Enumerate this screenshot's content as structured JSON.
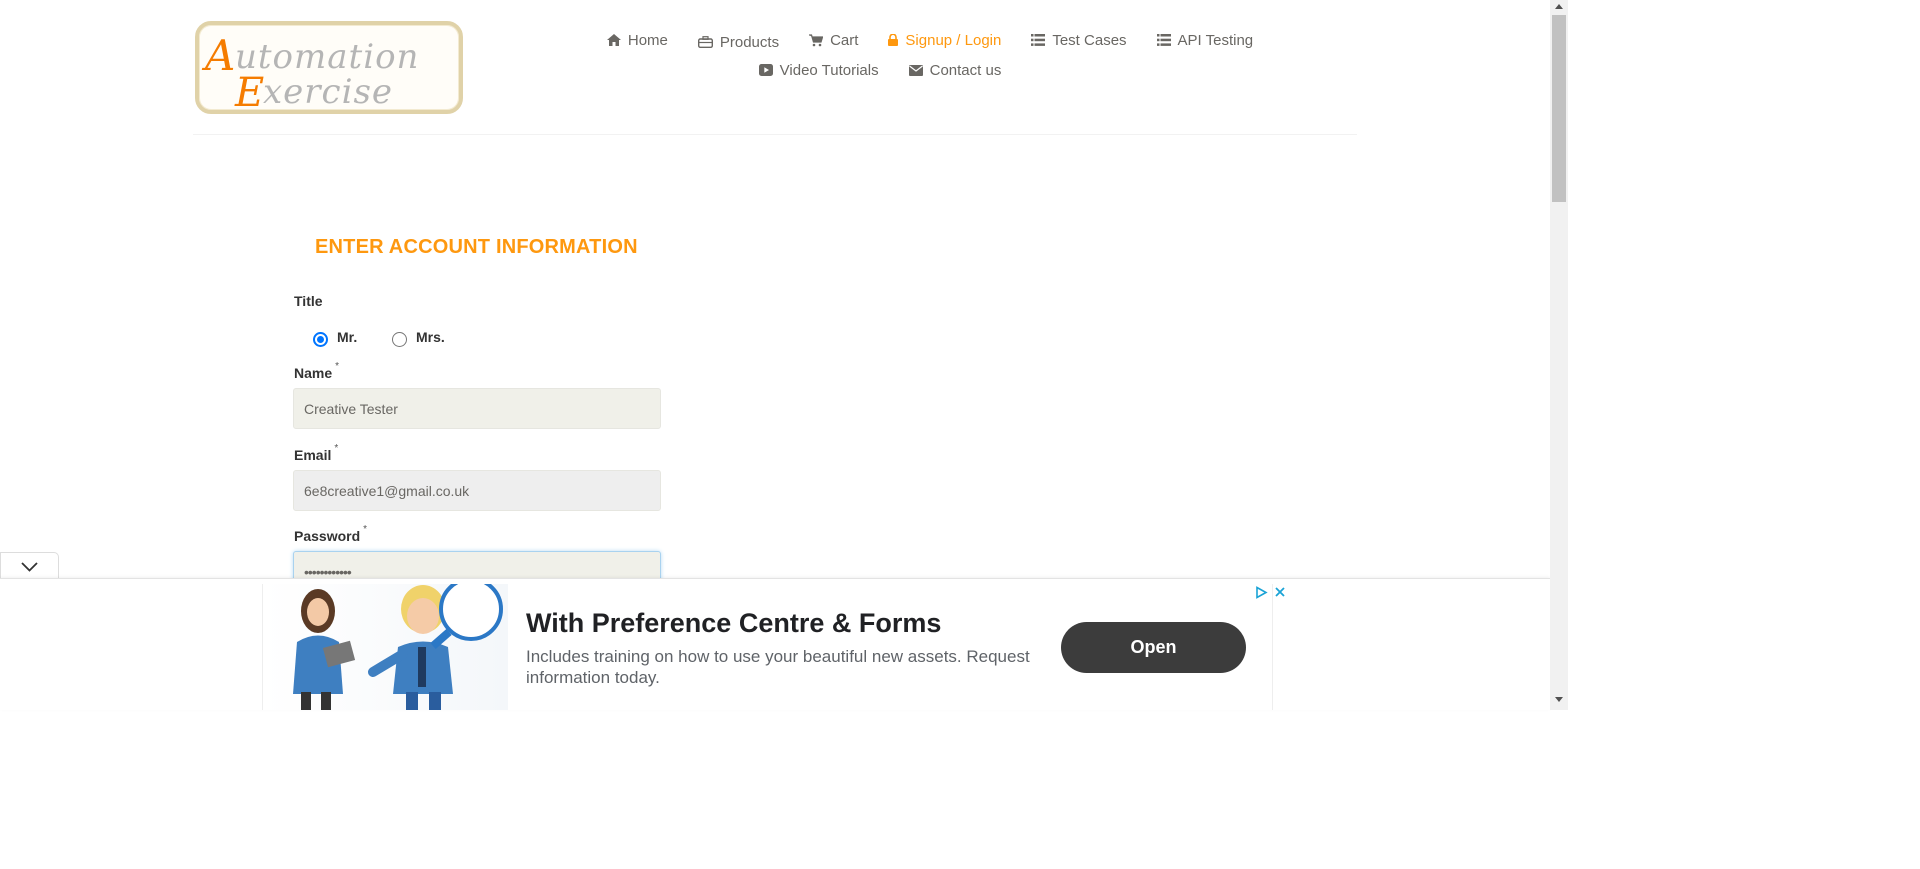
{
  "logo": {
    "line1": "Automation",
    "line2": "Exercise"
  },
  "nav": {
    "row1": [
      {
        "label": "Home",
        "icon": "home-icon",
        "active": false
      },
      {
        "label": "Products",
        "icon": "briefcase-icon",
        "active": false
      },
      {
        "label": "Cart",
        "icon": "cart-icon",
        "active": false
      },
      {
        "label": "Signup / Login",
        "icon": "lock-icon",
        "active": true
      },
      {
        "label": "Test Cases",
        "icon": "list-icon",
        "active": false
      },
      {
        "label": "API Testing",
        "icon": "list-icon",
        "active": false
      }
    ],
    "row2": [
      {
        "label": "Video Tutorials",
        "icon": "youtube-icon",
        "active": false
      },
      {
        "label": "Contact us",
        "icon": "envelope-icon",
        "active": false
      }
    ]
  },
  "form": {
    "title": "ENTER ACCOUNT INFORMATION",
    "title_label": "Title",
    "radio_mr": "Mr.",
    "radio_mrs": "Mrs.",
    "selected_title": "Mr.",
    "name_label": "Name",
    "name_value": "Creative Tester",
    "email_label": "Email",
    "email_value": "6e8creative1@gmail.co.uk",
    "password_label": "Password",
    "password_value": "••••••••••••",
    "required_mark": "*"
  },
  "ad": {
    "headline": "With Preference Centre & Forms",
    "body": "Includes training on how to use your beautiful new assets. Request information today.",
    "button": "Open"
  },
  "colors": {
    "accent": "#FE980F",
    "radio": "#0075ff",
    "ad_button": "#3c3c3c"
  }
}
